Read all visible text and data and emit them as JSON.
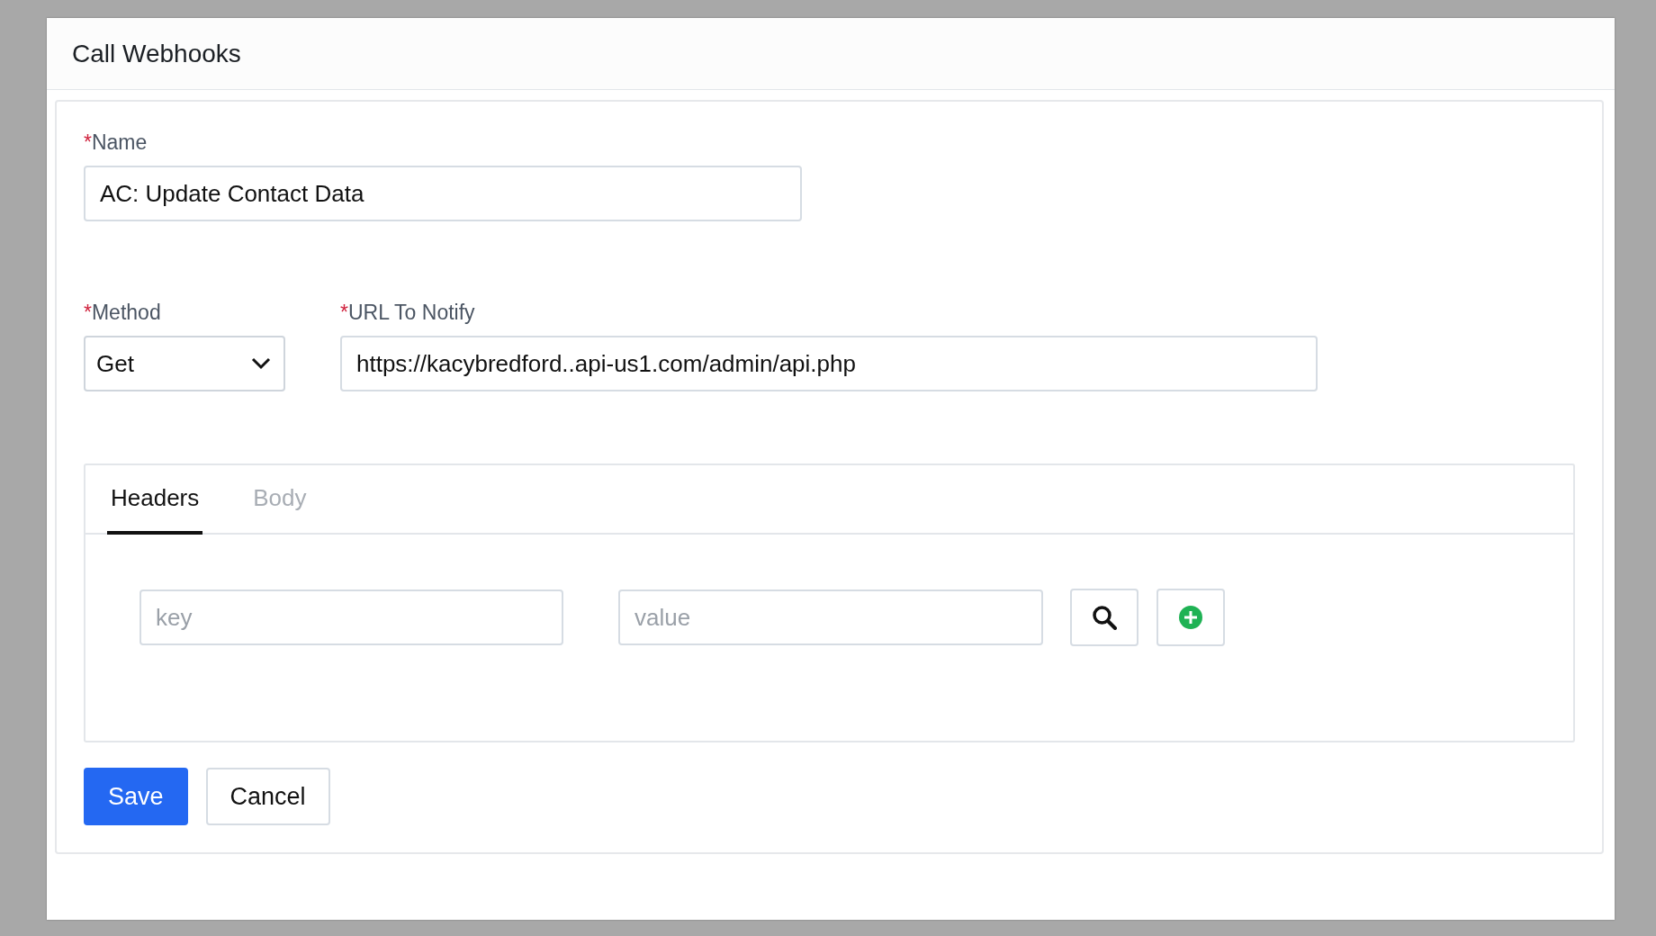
{
  "dialog": {
    "title": "Call Webhooks"
  },
  "name_field": {
    "marker": "*",
    "label": "Name",
    "value": "AC: Update Contact Data"
  },
  "method_field": {
    "marker": "*",
    "label": "Method",
    "value": "Get"
  },
  "url_field": {
    "marker": "*",
    "label": "URL To Notify",
    "value": "https://kacybredford..api-us1.com/admin/api.php"
  },
  "tabs": [
    {
      "label": "Headers",
      "selected": true
    },
    {
      "label": "Body",
      "selected": false
    }
  ],
  "header_row": {
    "key": {
      "placeholder": "key"
    },
    "value": {
      "placeholder": "value"
    }
  },
  "buttons": [
    {
      "kind": "primary",
      "label": "Save"
    },
    {
      "kind": "secondary",
      "label": "Cancel"
    }
  ]
}
